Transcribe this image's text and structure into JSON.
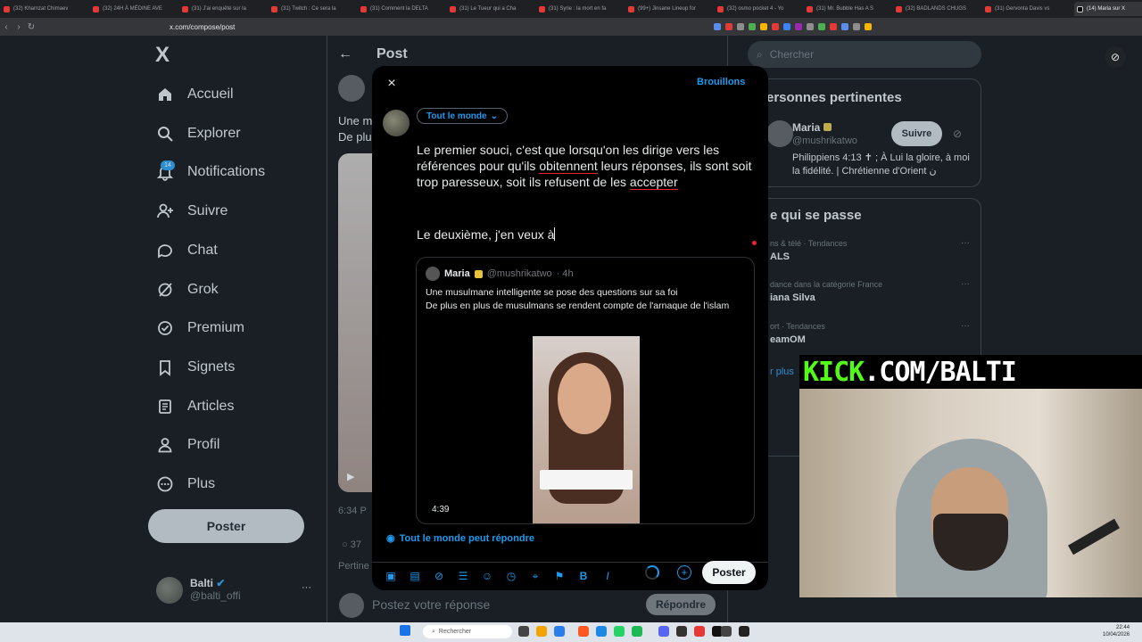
{
  "browser": {
    "tabs": [
      "(32) Khamzat Chimaev",
      "(32) 24H À MÉDINE AVE",
      "(31) J'ai enquêté sur la",
      "(31) Twitch : Ce sera la",
      "(31) Comment la DELTA",
      "(31) Le Tueur qui a Cha",
      "(31) Syrie : la mort en fa",
      "(99+) Jinsane Lineup for",
      "(32) osmo pocket 4 - Yo",
      "(31) Mr. Bubble Has A S",
      "(32) BADLANDS CHUGS",
      "(31) Gervonta Davis vs",
      "(14) Maria sur X"
    ],
    "url": "x.com/compose/post"
  },
  "sidebar": {
    "logo": "X",
    "items": [
      {
        "label": "Accueil",
        "icon": "home-icon"
      },
      {
        "label": "Explorer",
        "icon": "search-icon"
      },
      {
        "label": "Notifications",
        "icon": "bell-icon"
      },
      {
        "label": "Suivre",
        "icon": "add-user-icon"
      },
      {
        "label": "Chat",
        "icon": "chat-icon"
      },
      {
        "label": "Grok",
        "icon": "grok-icon"
      },
      {
        "label": "Premium",
        "icon": "premium-icon"
      },
      {
        "label": "Signets",
        "icon": "bookmark-icon"
      },
      {
        "label": "Articles",
        "icon": "article-icon"
      },
      {
        "label": "Profil",
        "icon": "profile-icon"
      },
      {
        "label": "Plus",
        "icon": "more-icon"
      }
    ],
    "notif_badge": "14",
    "post_button": "Poster",
    "account": {
      "name": "Balti",
      "handle": "@balti_offi"
    }
  },
  "feed": {
    "header": "Post",
    "bg_snippet_1": "Une m",
    "bg_snippet_2": "De plu",
    "time_snippet": "6:34 P",
    "replies_count": "37",
    "pertinent_snippet": "Pertine",
    "reply_placeholder": "Postez votre réponse",
    "reply_button": "Répondre"
  },
  "right": {
    "search_placeholder": "Chercher",
    "people_title": "ersonnes pertinentes",
    "person": {
      "name": "Maria",
      "handle": "@mushrikatwo",
      "follow": "Suivre",
      "bio": "Philippiens 4:13 ✝ ; À Lui la gloire, à moi la fidélité. | Chrétienne d'Orient ن"
    },
    "happening_title": "e qui se passe",
    "trends": [
      {
        "category": "ns & télé · Tendances",
        "name": "ALS"
      },
      {
        "category": "dance dans la catégorie France",
        "name": "iana Silva"
      },
      {
        "category": "ort · Tendances",
        "name": "eamOM"
      }
    ],
    "show_more": "r plus"
  },
  "modal": {
    "close": "×",
    "drafts": "Brouillons",
    "audience": "Tout le monde",
    "text_part1": "Le premier souci, c'est que lorsqu'on les dirige vers les références pour qu'ils ",
    "text_misspelled_1": "obitennent",
    "text_part2": " leurs réponses, ils sont soit trop paresseux, soit ils refusent de les ",
    "text_misspelled_2": "accepter",
    "text_line2": "Le deuxième, j'en veux à",
    "quote": {
      "name": "Maria",
      "handle": "@mushrikatwo",
      "time": "· 4h",
      "text_line1": "Une musulmane intelligente se pose des questions sur sa foi",
      "text_line2": "De plus en plus de musulmans se rendent compte de l'arnaque de l'islam",
      "video_duration": "4:39"
    },
    "reply_setting": "Tout le monde peut répondre",
    "post_button": "Poster"
  },
  "overlay": {
    "kick_part1": "KICK",
    "kick_part2": ".COM/BALTI"
  },
  "taskbar": {
    "search": "Rechercher",
    "time": "22:44",
    "date": "10/04/2026"
  }
}
